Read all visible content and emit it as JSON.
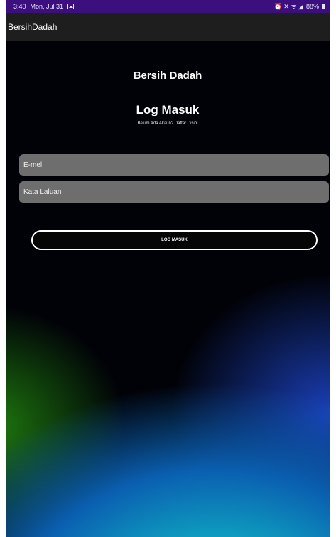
{
  "status_bar": {
    "time": "3:40",
    "date": "Mon, Jul 31",
    "right_icons_text": "⏰ ✕ ᯤ ◢",
    "battery": "88%"
  },
  "app_bar": {
    "title": "BersihDadah"
  },
  "login": {
    "app_name": "Bersih Dadah",
    "heading": "Log Masuk",
    "signup_text": "Belum Ada Akaun? Daftar Disini",
    "email_placeholder": "E-mel",
    "password_placeholder": "Kata Laluan",
    "button_label": "LOG MASUK"
  },
  "colors": {
    "status_bar": "#3b0f7d",
    "app_bar": "#1e1e1e",
    "field_background": "#6e6e6e",
    "button_border": "#ffffff"
  }
}
